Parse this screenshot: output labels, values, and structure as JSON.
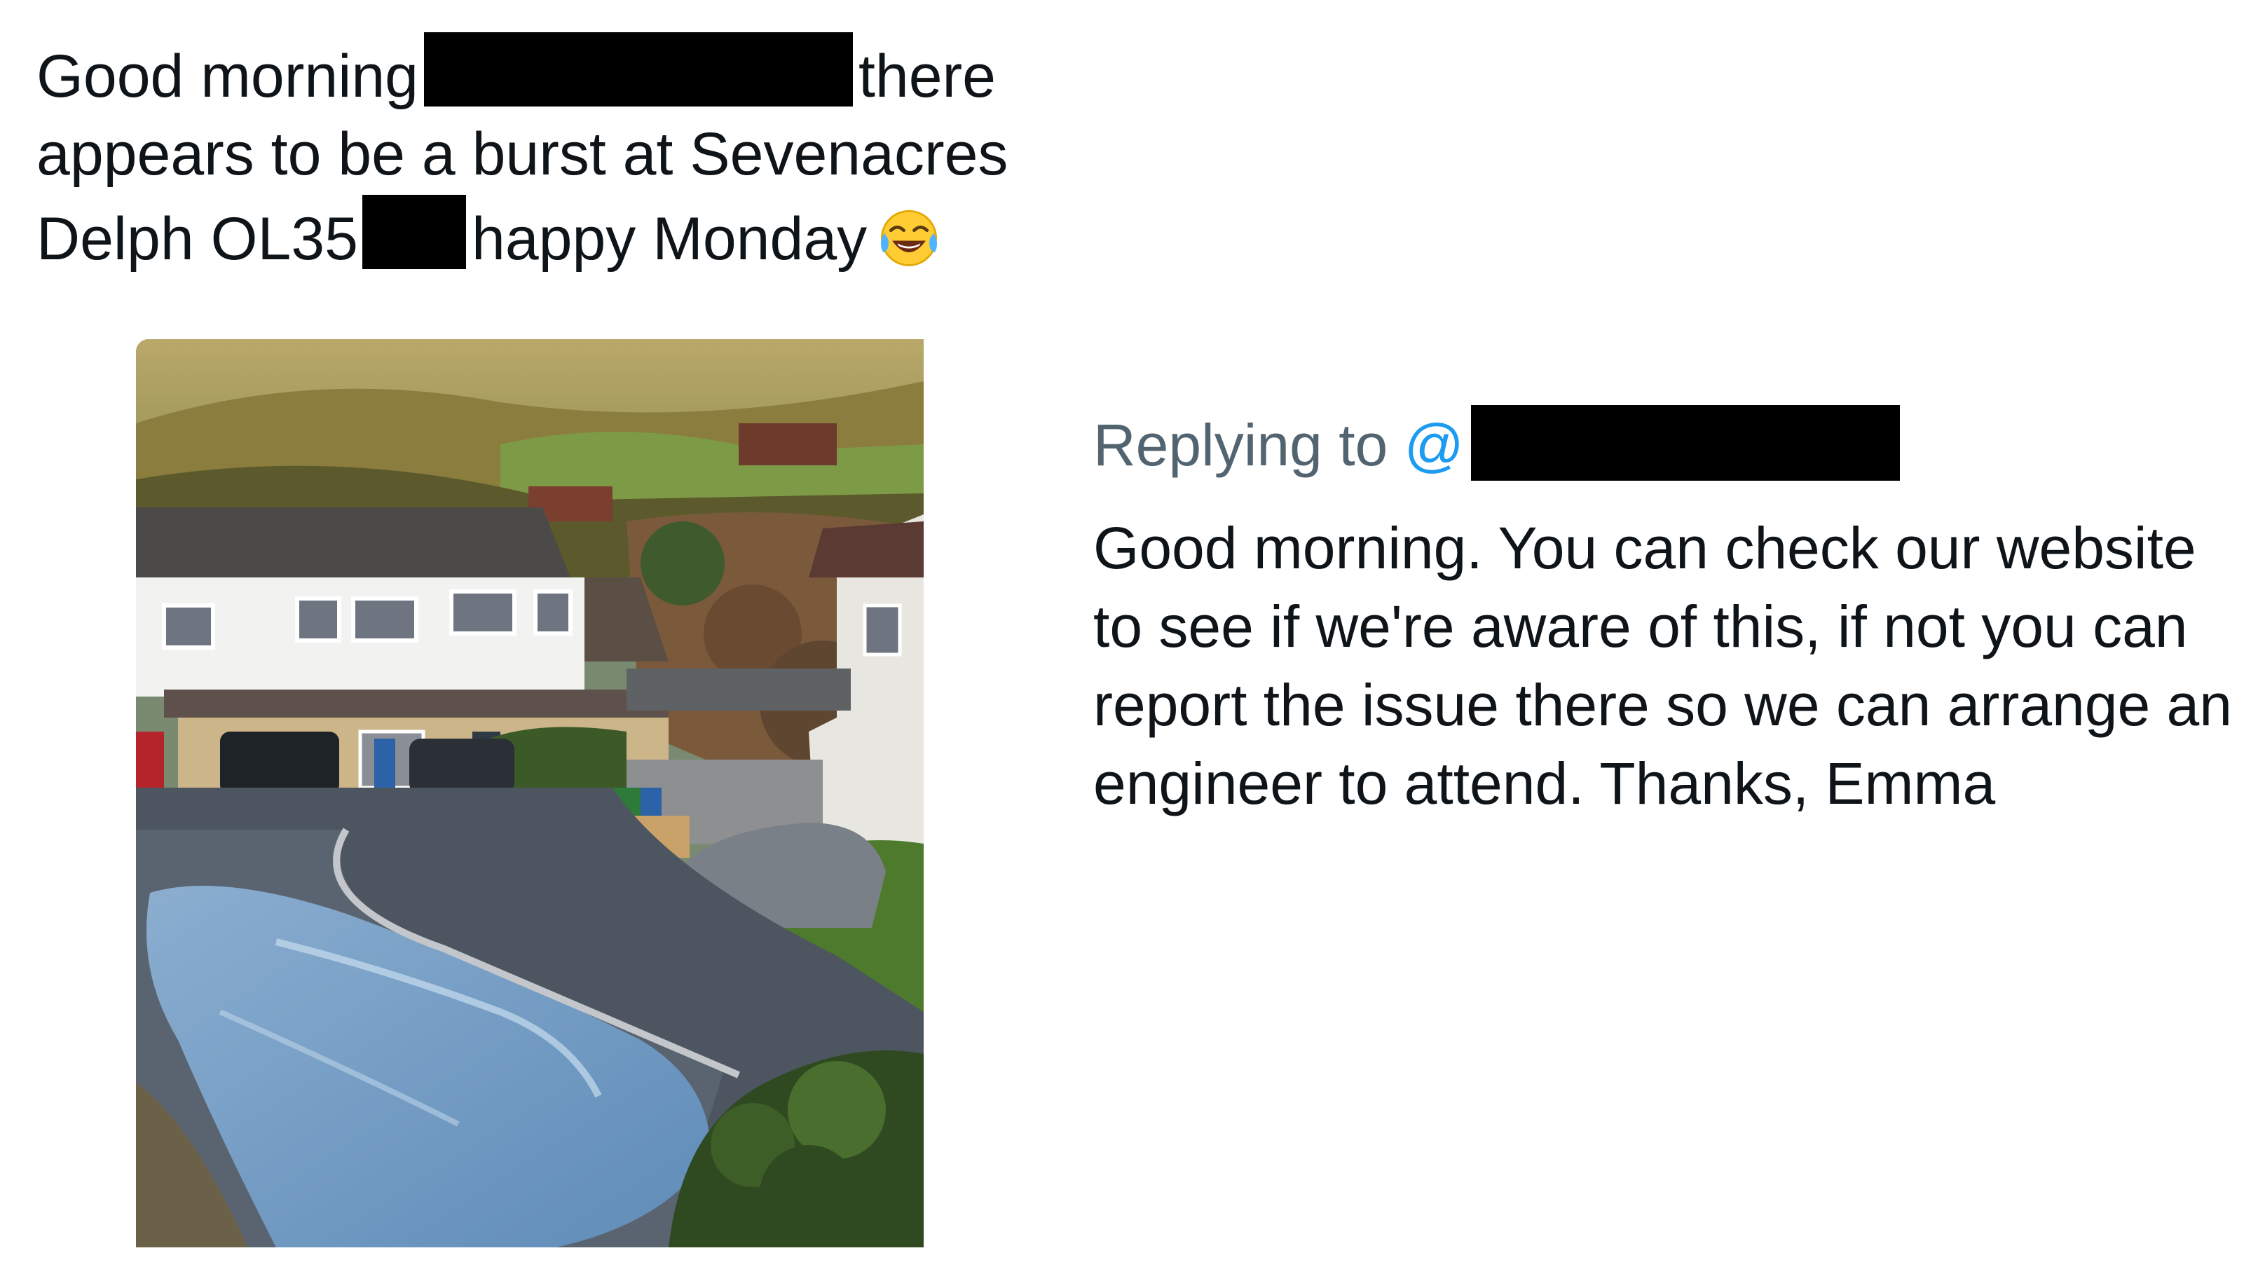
{
  "original_tweet": {
    "text_lines": [
      {
        "before": "Good morning",
        "after": "there"
      },
      {
        "full": "appears to be a burst at Sevenacres"
      },
      {
        "before": "Delph OL35",
        "after": "happy Monday"
      }
    ],
    "emoji": "face-with-tears-of-joy",
    "photo_alt": "street with water from burst pipe"
  },
  "reply": {
    "replying_prefix": "Replying to",
    "mention_symbol": "@",
    "text": "Good morning. You can check our website to see if we're aware of this, if not you can report the issue there so we can arrange an engineer to attend. Thanks, Emma"
  },
  "colors": {
    "text": "#0f1419",
    "muted": "#536471",
    "link": "#1d9bf0",
    "redaction": "#000000"
  }
}
